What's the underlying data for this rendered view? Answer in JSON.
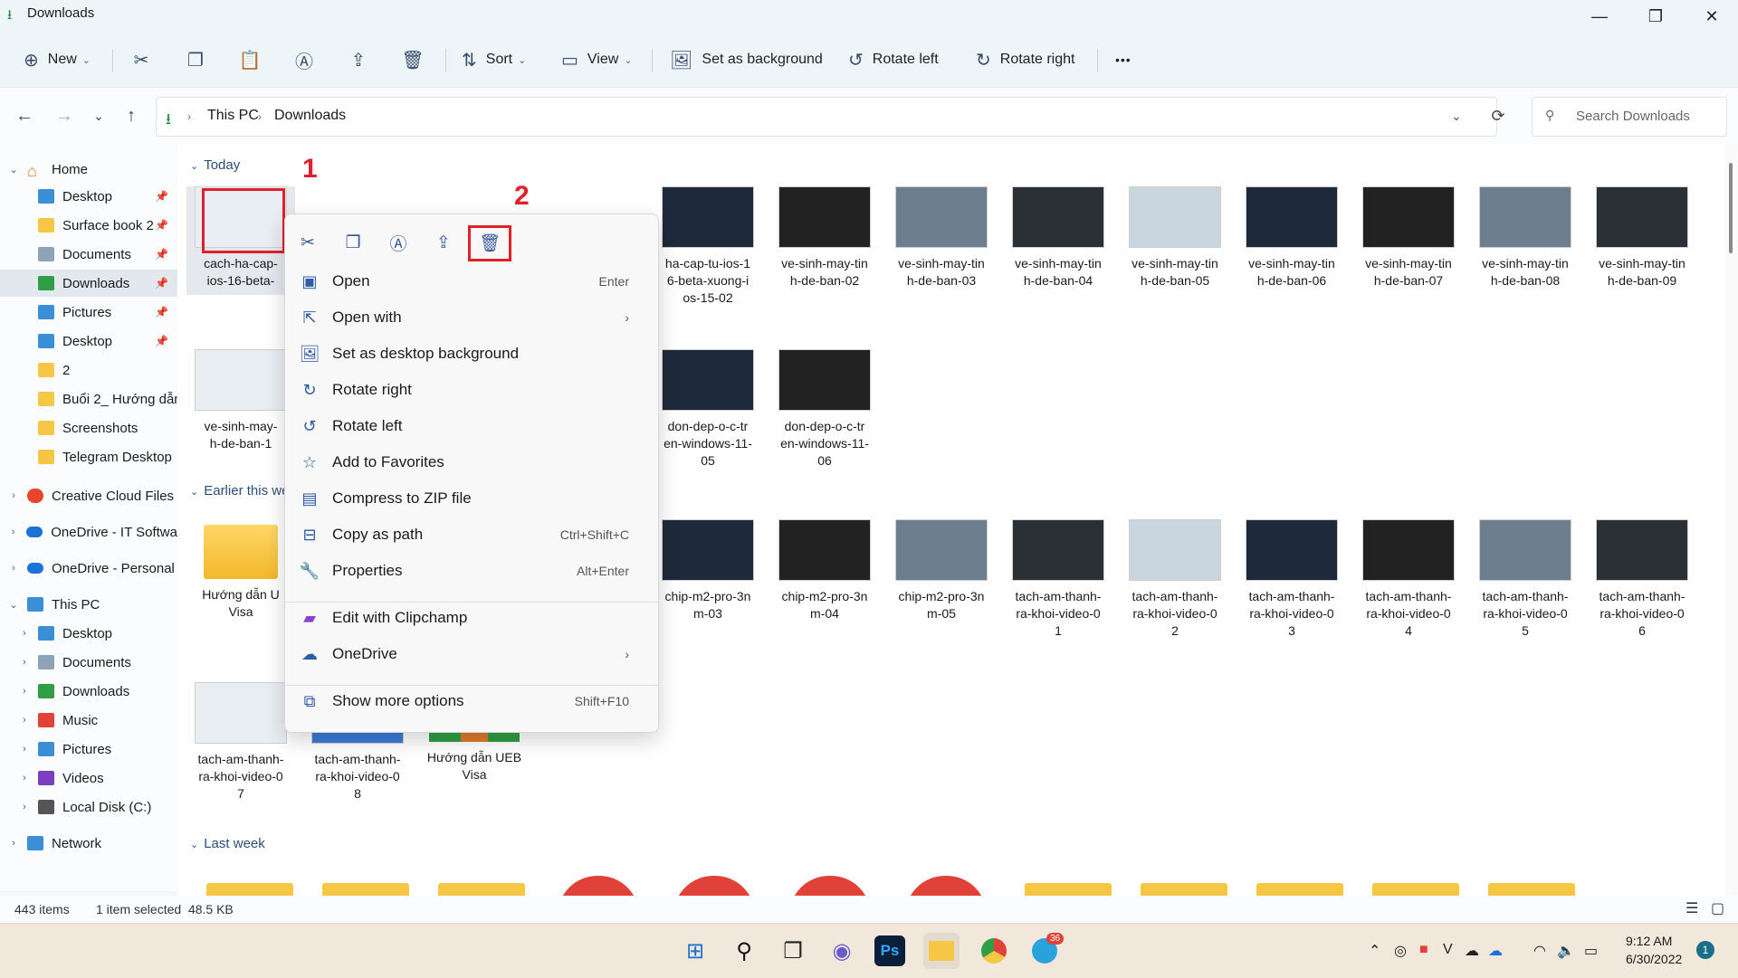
{
  "window": {
    "title": "Downloads"
  },
  "toolbar": {
    "new_label": "New",
    "sort_label": "Sort",
    "view_label": "View",
    "set_background_label": "Set as background",
    "rotate_left_label": "Rotate left",
    "rotate_right_label": "Rotate right",
    "more_glyph": "•••"
  },
  "address": {
    "this_pc": "This PC",
    "downloads": "Downloads",
    "search_placeholder": "Search Downloads"
  },
  "sidebar": {
    "home": "Home",
    "quick": [
      {
        "label": "Desktop",
        "pinned": true
      },
      {
        "label": "Surface book 2",
        "pinned": true
      },
      {
        "label": "Documents",
        "pinned": true
      },
      {
        "label": "Downloads",
        "pinned": true
      },
      {
        "label": "Pictures",
        "pinned": true
      },
      {
        "label": "Desktop",
        "pinned": true
      },
      {
        "label": "2",
        "pinned": false
      },
      {
        "label": "Buổi 2_ Hướng dẫn",
        "pinned": false
      },
      {
        "label": "Screenshots",
        "pinned": false
      },
      {
        "label": "Telegram Desktop",
        "pinned": false
      }
    ],
    "creative_cloud": "Creative Cloud Files",
    "onedrive_it": "OneDrive - IT Softwa",
    "onedrive_personal": "OneDrive - Personal",
    "this_pc": "This PC",
    "pc_items": [
      "Desktop",
      "Documents",
      "Downloads",
      "Music",
      "Pictures",
      "Videos",
      "Local Disk (C:)"
    ],
    "network": "Network"
  },
  "groups": {
    "today": "Today",
    "earlier": "Earlier this we",
    "last_week": "Last week"
  },
  "files": {
    "today_row1": [
      "cach-ha-cap-\nios-16-beta-",
      "ha-cap-tu-ios-1\n6-beta-xuong-i\nos-15-02",
      "ve-sinh-may-tin\nh-de-ban-02",
      "ve-sinh-may-tin\nh-de-ban-03",
      "ve-sinh-may-tin\nh-de-ban-04",
      "ve-sinh-may-tin\nh-de-ban-05",
      "ve-sinh-may-tin\nh-de-ban-06",
      "ve-sinh-may-tin\nh-de-ban-07",
      "ve-sinh-may-tin\nh-de-ban-08",
      "ve-sinh-may-tin\nh-de-ban-09"
    ],
    "today_row2": [
      "ve-sinh-may-\nh-de-ban-1",
      "don-dep-o-c-tr\nen-windows-11-\n05",
      "don-dep-o-c-tr\nen-windows-11-\n06"
    ],
    "earlier_row1": [
      "Hướng dẫn U\nVisa",
      "chip-m2-pro-3n\nm-03",
      "chip-m2-pro-3n\nm-04",
      "chip-m2-pro-3n\nm-05",
      "tach-am-thanh-\nra-khoi-video-0\n1",
      "tach-am-thanh-\nra-khoi-video-0\n2",
      "tach-am-thanh-\nra-khoi-video-0\n3",
      "tach-am-thanh-\nra-khoi-video-0\n4",
      "tach-am-thanh-\nra-khoi-video-0\n5",
      "tach-am-thanh-\nra-khoi-video-0\n6"
    ],
    "earlier_row2": [
      "tach-am-thanh-\nra-khoi-video-0\n7",
      "tach-am-thanh-\nra-khoi-video-0\n8",
      "Hướng dẫn UEB\nVisa"
    ]
  },
  "context_menu": {
    "items": [
      {
        "label": "Open",
        "shortcut": "Enter"
      },
      {
        "label": "Open with",
        "shortcut": "›"
      },
      {
        "label": "Set as desktop background",
        "shortcut": ""
      },
      {
        "label": "Rotate right",
        "shortcut": ""
      },
      {
        "label": "Rotate left",
        "shortcut": ""
      },
      {
        "label": "Add to Favorites",
        "shortcut": ""
      },
      {
        "label": "Compress to ZIP file",
        "shortcut": ""
      },
      {
        "label": "Copy as path",
        "shortcut": "Ctrl+Shift+C"
      },
      {
        "label": "Properties",
        "shortcut": "Alt+Enter"
      },
      {
        "label": "Edit with Clipchamp",
        "shortcut": ""
      },
      {
        "label": "OneDrive",
        "shortcut": "›"
      },
      {
        "label": "Show more options",
        "shortcut": "Shift+F10"
      }
    ]
  },
  "annotations": {
    "label1": "1",
    "label2": "2"
  },
  "status": {
    "items": "443 items",
    "selected": "1 item selected  48.5 KB"
  },
  "taskbar": {
    "time": "9:12 AM",
    "date": "6/30/2022",
    "notif_count": "1",
    "telegram_badge": "36",
    "ps_label": "Ps"
  },
  "colors": {
    "accent": "#2d5ba8",
    "highlight": "#e0202a",
    "taskbar": "#f1e7db"
  }
}
